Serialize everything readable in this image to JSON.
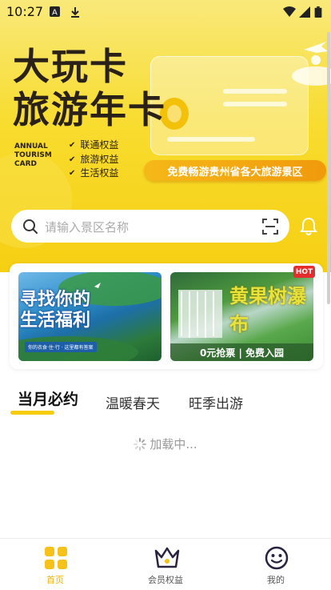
{
  "status_bar": {
    "time": "10:27"
  },
  "banner": {
    "title_line1": "大玩卡",
    "title_line2": "旅游年卡",
    "english": [
      "ANNUAL",
      "TOURISM",
      "CARD"
    ],
    "benefits": [
      "联通权益",
      "旅游权益",
      "生活权益"
    ],
    "pill_text": "免费畅游贵州省各大旅游景区"
  },
  "search": {
    "placeholder": "请输入景区名称"
  },
  "promo_cards": [
    {
      "title_lines": [
        "寻找你的",
        "生活福利"
      ],
      "subtitle": "你的衣食·住·行 · 这里都有答案"
    },
    {
      "title": "黄果树瀑布",
      "bottom": "0元抢票 | 免费入园",
      "badge": "HOT"
    }
  ],
  "tabs": [
    "当月必约",
    "温暖春天",
    "旺季出游"
  ],
  "loading_text": "加载中...",
  "bottom_nav": [
    {
      "label": "首页",
      "icon": "home-grid-icon",
      "active": true
    },
    {
      "label": "会员权益",
      "icon": "crown-icon",
      "active": false
    },
    {
      "label": "我的",
      "icon": "smiley-icon",
      "active": false
    }
  ],
  "colors": {
    "accent": "#f6cc10",
    "pill": "#f09a0c",
    "hot": "#e62d2d",
    "nav_active": "#f0b400"
  }
}
